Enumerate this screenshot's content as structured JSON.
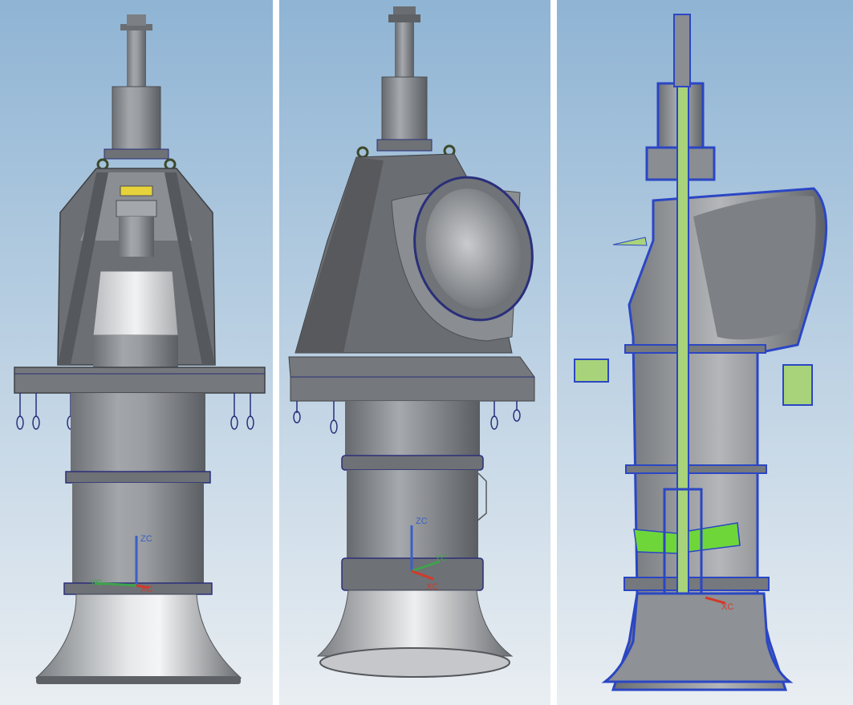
{
  "colors": {
    "sky_top": "#8fb4d4",
    "sky_bottom": "#e9eef2",
    "steel_dark": "#5f6266",
    "steel_mid": "#8a8d91",
    "steel_light": "#c8cacc",
    "bolt_blue": "#2a2f7a",
    "section_outline": "#2b46c4",
    "shaft_green": "#a9d37a",
    "blade_green": "#6fd63a",
    "axis_z": "#3a5fc8",
    "axis_y": "#3fa34d",
    "axis_x": "#d23a2a"
  },
  "panels": [
    {
      "id": "front-view",
      "axes": {
        "z": "ZC",
        "y": "YC",
        "x": "XC"
      }
    },
    {
      "id": "isometric-view",
      "axes": {
        "z": "ZC",
        "y": "YC",
        "x": "XC"
      }
    },
    {
      "id": "section-view",
      "axes": {
        "z": "",
        "y": "",
        "x": "XC"
      }
    }
  ]
}
